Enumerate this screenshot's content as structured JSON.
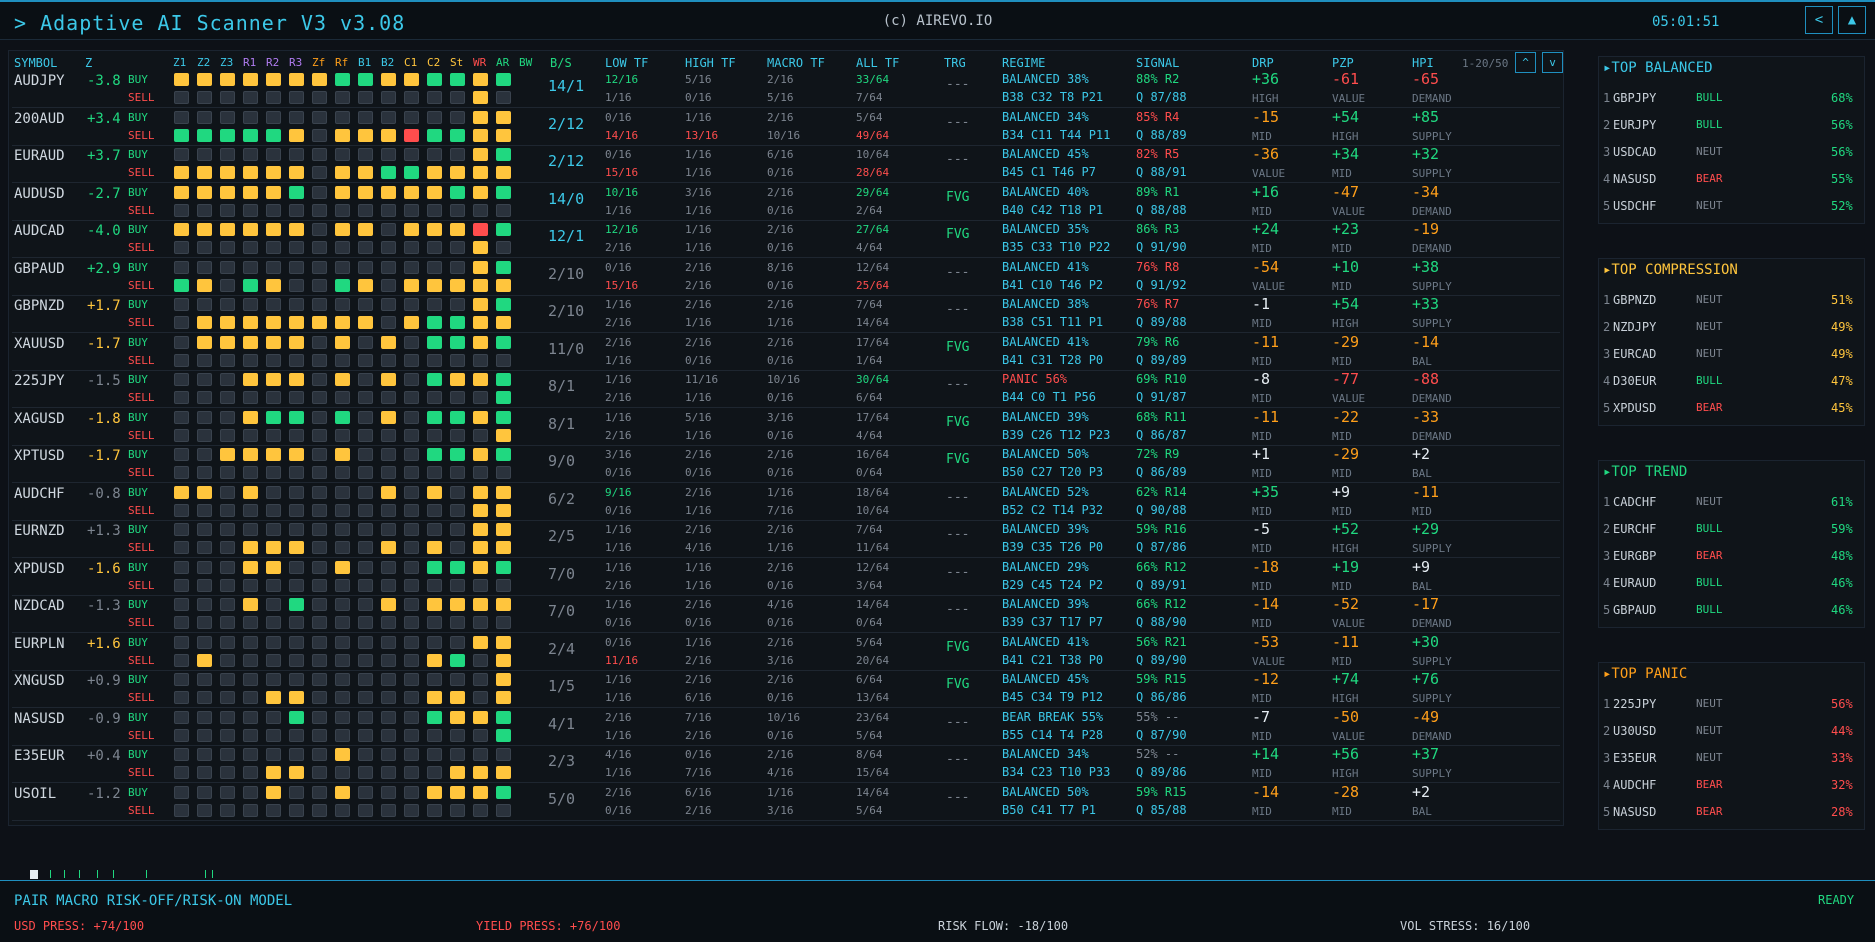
{
  "header": {
    "title": "> Adaptive AI Scanner V3 v3.08",
    "copyright": "(c) AIREVO.IO",
    "time": "05:01:51",
    "prev_icon": "<",
    "up_icon": "▲"
  },
  "columns": [
    "SYMBOL",
    "Z",
    "Z1",
    "Z2",
    "Z3",
    "R1",
    "R2",
    "R3",
    "Zf",
    "Rf",
    "B1",
    "B2",
    "C1",
    "C2",
    "St",
    "WR",
    "AR",
    "BW",
    "B/S",
    "LOW TF",
    "HIGH TF",
    "MACRO TF",
    "ALL TF",
    "TRG",
    "REGIME",
    "SIGNAL",
    "DRP",
    "PZP",
    "HPI"
  ],
  "pager": {
    "range": "1-20/50",
    "up": "^",
    "down": "v"
  },
  "side_labels": {
    "buy": "BUY",
    "sell": "SELL"
  },
  "colors": {
    "accent": "#3cc8e8",
    "green": "#20d880",
    "yellow": "#ffc53d",
    "red": "#ff4d4d",
    "orange": "#ff9f1a",
    "gray": "#7d8590"
  },
  "rows": [
    {
      "symbol": "AUDJPY",
      "z": "-3.8",
      "zc": "green",
      "bs": "14/1",
      "bsc": "cyan",
      "tf": [
        "12/16",
        "1/16",
        "5/16",
        "0/16",
        "2/16",
        "5/16",
        "33/64",
        "7/64"
      ],
      "trg": "---",
      "regime": "BALANCED 38%",
      "regime_sub": "B38 C32 T8 P21",
      "sig": "88% R2",
      "sig_sub": "Q 87/88",
      "drp": "+36",
      "drp_l": "HIGH",
      "pzp": "-61",
      "pzp_l": "VALUE",
      "hpi": "-65",
      "hpi_l": "DEMAND",
      "buy": "YYYYYYYGGYYGGYG",
      "sell": "KKKKKKKKKKKKKYK"
    },
    {
      "symbol": "200AUD",
      "z": "+3.4",
      "zc": "green",
      "bs": "2/12",
      "bsc": "cyan",
      "tf": [
        "0/16",
        "14/16",
        "1/16",
        "13/16",
        "2/16",
        "10/16",
        "5/64",
        "49/64"
      ],
      "trg": "---",
      "regime": "BALANCED 34%",
      "regime_sub": "B34 C11 T44 P11",
      "sig": "85% R4",
      "sig_sub": "Q 88/89",
      "drp": "-15",
      "drp_l": "MID",
      "pzp": "+54",
      "pzp_l": "HIGH",
      "hpi": "+85",
      "hpi_l": "SUPPLY",
      "buy": "KKKKKKKKKKKKKYY",
      "sell": "GGGGGYKYYYRGGYY"
    },
    {
      "symbol": "EURAUD",
      "z": "+3.7",
      "zc": "green",
      "bs": "2/12",
      "bsc": "cyan",
      "tf": [
        "0/16",
        "15/16",
        "1/16",
        "1/16",
        "6/16",
        "0/16",
        "10/64",
        "28/64"
      ],
      "trg": "---",
      "regime": "BALANCED 45%",
      "regime_sub": "B45 C1 T46 P7",
      "sig": "82% R5",
      "sig_sub": "Q 88/91",
      "drp": "-36",
      "drp_l": "VALUE",
      "pzp": "+34",
      "pzp_l": "MID",
      "hpi": "+32",
      "hpi_l": "SUPPLY",
      "buy": "KKKKKKKKKKKKKYG",
      "sell": "YYYYYYKYYGGYYYY"
    },
    {
      "symbol": "AUDUSD",
      "z": "-2.7",
      "zc": "green",
      "bs": "14/0",
      "bsc": "cyan",
      "tf": [
        "10/16",
        "1/16",
        "3/16",
        "1/16",
        "2/16",
        "0/16",
        "29/64",
        "2/64"
      ],
      "trg": "FVG",
      "regime": "BALANCED 40%",
      "regime_sub": "B40 C42 T18 P1",
      "sig": "89% R1",
      "sig_sub": "Q 88/88",
      "drp": "+16",
      "drp_l": "MID",
      "pzp": "-47",
      "pzp_l": "VALUE",
      "hpi": "-34",
      "hpi_l": "DEMAND",
      "buy": "YYYYYGKYYYYYGYG",
      "sell": "KKKKKKKKKKKKKKK"
    },
    {
      "symbol": "AUDCAD",
      "z": "-4.0",
      "zc": "green",
      "bs": "12/1",
      "bsc": "cyan",
      "tf": [
        "12/16",
        "2/16",
        "1/16",
        "1/16",
        "2/16",
        "0/16",
        "27/64",
        "4/64"
      ],
      "trg": "FVG",
      "regime": "BALANCED 35%",
      "regime_sub": "B35 C33 T10 P22",
      "sig": "86% R3",
      "sig_sub": "Q 91/90",
      "drp": "+24",
      "drp_l": "MID",
      "pzp": "+23",
      "pzp_l": "MID",
      "hpi": "-19",
      "hpi_l": "DEMAND",
      "buy": "YYYYYYKYYKYYYRG",
      "sell": "KKKKKKKKKKKKKYK"
    },
    {
      "symbol": "GBPAUD",
      "z": "+2.9",
      "zc": "green",
      "bs": "2/10",
      "bsc": "gray",
      "tf": [
        "0/16",
        "15/16",
        "2/16",
        "2/16",
        "8/16",
        "0/16",
        "12/64",
        "25/64"
      ],
      "trg": "---",
      "regime": "BALANCED 41%",
      "regime_sub": "B41 C10 T46 P2",
      "sig": "76% R8",
      "sig_sub": "Q 91/92",
      "drp": "-54",
      "drp_l": "VALUE",
      "pzp": "+10",
      "pzp_l": "MID",
      "hpi": "+38",
      "hpi_l": "SUPPLY",
      "buy": "KKKKKKKKKKKKKYG",
      "sell": "GYKGYKKGYKYYYYY"
    },
    {
      "symbol": "GBPNZD",
      "z": "+1.7",
      "zc": "yellow",
      "bs": "2/10",
      "bsc": "gray",
      "tf": [
        "1/16",
        "2/16",
        "2/16",
        "1/16",
        "2/16",
        "1/16",
        "7/64",
        "14/64"
      ],
      "trg": "---",
      "regime": "BALANCED 38%",
      "regime_sub": "B38 C51 T11 P1",
      "sig": "76% R7",
      "sig_sub": "Q 89/88",
      "drp": "-1",
      "drp_l": "MID",
      "pzp": "+54",
      "pzp_l": "HIGH",
      "hpi": "+33",
      "hpi_l": "SUPPLY",
      "buy": "KKKKKKKKKKKKKYG",
      "sell": "KYYYYYYYYKYGGYY"
    },
    {
      "symbol": "XAUUSD",
      "z": "-1.7",
      "zc": "yellow",
      "bs": "11/0",
      "bsc": "gray",
      "tf": [
        "2/16",
        "1/16",
        "2/16",
        "0/16",
        "2/16",
        "0/16",
        "17/64",
        "1/64"
      ],
      "trg": "FVG",
      "regime": "BALANCED 41%",
      "regime_sub": "B41 C31 T28 P0",
      "sig": "79% R6",
      "sig_sub": "Q 89/89",
      "drp": "-11",
      "drp_l": "MID",
      "pzp": "-29",
      "pzp_l": "MID",
      "hpi": "-14",
      "hpi_l": "BAL",
      "buy": "KYYYYYKYKYKGGYG",
      "sell": "KKKKKKKKKKKKKKK"
    },
    {
      "symbol": "225JPY",
      "z": "-1.5",
      "zc": "gray",
      "bs": "8/1",
      "bsc": "gray",
      "tf": [
        "1/16",
        "2/16",
        "11/16",
        "1/16",
        "10/16",
        "0/16",
        "30/64",
        "6/64"
      ],
      "trg": "---",
      "regime": "PANIC 56%",
      "regime_sub": "B44 C0 T1 P56",
      "sig": "69% R10",
      "sig_sub": "Q 91/87",
      "drp": "-8",
      "drp_l": "MID",
      "pzp": "-77",
      "pzp_l": "VALUE",
      "hpi": "-88",
      "hpi_l": "DEMAND",
      "buy": "KKKYYYKYKYKGYYG",
      "sell": "KKKKKKKKKKKKKKG"
    },
    {
      "symbol": "XAGUSD",
      "z": "-1.8",
      "zc": "yellow",
      "bs": "8/1",
      "bsc": "gray",
      "tf": [
        "1/16",
        "2/16",
        "5/16",
        "1/16",
        "3/16",
        "0/16",
        "17/64",
        "4/64"
      ],
      "trg": "FVG",
      "regime": "BALANCED 39%",
      "regime_sub": "B39 C26 T12 P23",
      "sig": "68% R11",
      "sig_sub": "Q 86/87",
      "drp": "-11",
      "drp_l": "MID",
      "pzp": "-22",
      "pzp_l": "MID",
      "hpi": "-33",
      "hpi_l": "DEMAND",
      "buy": "KKKYGGKGKYKGGYG",
      "sell": "KKKKKKKKKKKKKKY"
    },
    {
      "symbol": "XPTUSD",
      "z": "-1.7",
      "zc": "yellow",
      "bs": "9/0",
      "bsc": "gray",
      "tf": [
        "3/16",
        "0/16",
        "2/16",
        "0/16",
        "2/16",
        "0/16",
        "16/64",
        "0/64"
      ],
      "trg": "FVG",
      "regime": "BALANCED 50%",
      "regime_sub": "B50 C27 T20 P3",
      "sig": "72% R9",
      "sig_sub": "Q 86/89",
      "drp": "+1",
      "drp_l": "MID",
      "pzp": "-29",
      "pzp_l": "MID",
      "hpi": "+2",
      "hpi_l": "BAL",
      "buy": "KKYYYYKYKKKGGYG",
      "sell": "KKKKKKKKKKKKKKK"
    },
    {
      "symbol": "AUDCHF",
      "z": "-0.8",
      "zc": "gray",
      "bs": "6/2",
      "bsc": "gray",
      "tf": [
        "9/16",
        "0/16",
        "2/16",
        "1/16",
        "1/16",
        "7/16",
        "18/64",
        "10/64"
      ],
      "trg": "---",
      "regime": "BALANCED 52%",
      "regime_sub": "B52 C2 T14 P32",
      "sig": "62% R14",
      "sig_sub": "Q 90/88",
      "drp": "+35",
      "drp_l": "MID",
      "pzp": "+9",
      "pzp_l": "MID",
      "hpi": "-11",
      "hpi_l": "MID",
      "buy": "YYKYKKKKKYKYKYY",
      "sell": "KKKKKKKKKKKKKYY"
    },
    {
      "symbol": "EURNZD",
      "z": "+1.3",
      "zc": "gray",
      "bs": "2/5",
      "bsc": "gray",
      "tf": [
        "1/16",
        "1/16",
        "2/16",
        "4/16",
        "2/16",
        "1/16",
        "7/64",
        "11/64"
      ],
      "trg": "---",
      "regime": "BALANCED 39%",
      "regime_sub": "B39 C35 T26 P0",
      "sig": "59% R16",
      "sig_sub": "Q 87/86",
      "drp": "-5",
      "drp_l": "MID",
      "pzp": "+52",
      "pzp_l": "HIGH",
      "hpi": "+29",
      "hpi_l": "SUPPLY",
      "buy": "KKKKKKKKKKKKKYY",
      "sell": "KKKYYYKKKYKYKYY"
    },
    {
      "symbol": "XPDUSD",
      "z": "-1.6",
      "zc": "yellow",
      "bs": "7/0",
      "bsc": "gray",
      "tf": [
        "1/16",
        "2/16",
        "1/16",
        "1/16",
        "2/16",
        "0/16",
        "12/64",
        "3/64"
      ],
      "trg": "---",
      "regime": "BALANCED 29%",
      "regime_sub": "B29 C45 T24 P2",
      "sig": "66% R12",
      "sig_sub": "Q 89/91",
      "drp": "-18",
      "drp_l": "MID",
      "pzp": "+19",
      "pzp_l": "MID",
      "hpi": "+9",
      "hpi_l": "BAL",
      "buy": "KKKYYKKYKKKGGYG",
      "sell": "KKKKKKKKKKKKKKK"
    },
    {
      "symbol": "NZDCAD",
      "z": "-1.3",
      "zc": "gray",
      "bs": "7/0",
      "bsc": "gray",
      "tf": [
        "1/16",
        "0/16",
        "2/16",
        "0/16",
        "4/16",
        "0/16",
        "14/64",
        "0/64"
      ],
      "trg": "---",
      "regime": "BALANCED 39%",
      "regime_sub": "B39 C37 T17 P7",
      "sig": "66% R12",
      "sig_sub": "Q 88/90",
      "drp": "-14",
      "drp_l": "MID",
      "pzp": "-52",
      "pzp_l": "VALUE",
      "hpi": "-17",
      "hpi_l": "DEMAND",
      "buy": "KKKYKGKKKYKYYYY",
      "sell": "KKKKKKKKKKKKKKK"
    },
    {
      "symbol": "EURPLN",
      "z": "+1.6",
      "zc": "yellow",
      "bs": "2/4",
      "bsc": "gray",
      "tf": [
        "0/16",
        "11/16",
        "1/16",
        "2/16",
        "2/16",
        "3/16",
        "5/64",
        "20/64"
      ],
      "trg": "FVG",
      "regime": "BALANCED 41%",
      "regime_sub": "B41 C21 T38 P0",
      "sig": "56% R21",
      "sig_sub": "Q 89/90",
      "drp": "-53",
      "drp_l": "VALUE",
      "pzp": "-11",
      "pzp_l": "MID",
      "hpi": "+30",
      "hpi_l": "SUPPLY",
      "buy": "KKKKKKKKKKKKKYY",
      "sell": "KYKKKKKKKKKYGKY"
    },
    {
      "symbol": "XNGUSD",
      "z": "+0.9",
      "zc": "gray",
      "bs": "1/5",
      "bsc": "gray",
      "tf": [
        "1/16",
        "1/16",
        "2/16",
        "6/16",
        "2/16",
        "0/16",
        "6/64",
        "13/64"
      ],
      "trg": "FVG",
      "regime": "BALANCED 45%",
      "regime_sub": "B45 C34 T9 P12",
      "sig": "59% R15",
      "sig_sub": "Q 86/86",
      "drp": "-12",
      "drp_l": "MID",
      "pzp": "+74",
      "pzp_l": "HIGH",
      "hpi": "+76",
      "hpi_l": "SUPPLY",
      "buy": "KKKKKKKKKKKKKKY",
      "sell": "KKKKYYKKKKKYYKY"
    },
    {
      "symbol": "NASUSD",
      "z": "-0.9",
      "zc": "gray",
      "bs": "4/1",
      "bsc": "gray",
      "tf": [
        "2/16",
        "1/16",
        "7/16",
        "2/16",
        "10/16",
        "0/16",
        "23/64",
        "5/64"
      ],
      "trg": "---",
      "regime": "BEAR BREAK 55%",
      "regime_sub": "B55 C14 T4 P28",
      "sig": "55% --",
      "sig_sub": "Q 87/90",
      "drp": "-7",
      "drp_l": "MID",
      "pzp": "-50",
      "pzp_l": "VALUE",
      "hpi": "-49",
      "hpi_l": "DEMAND",
      "buy": "KKKKKGKKKKKGYYG",
      "sell": "KKKKKKKKKKKKKKG"
    },
    {
      "symbol": "E35EUR",
      "z": "+0.4",
      "zc": "gray",
      "bs": "2/3",
      "bsc": "gray",
      "tf": [
        "4/16",
        "1/16",
        "0/16",
        "7/16",
        "2/16",
        "4/16",
        "8/64",
        "15/64"
      ],
      "trg": "---",
      "regime": "BALANCED 34%",
      "regime_sub": "B34 C23 T10 P33",
      "sig": "52% --",
      "sig_sub": "Q 89/86",
      "drp": "+14",
      "drp_l": "MID",
      "pzp": "+56",
      "pzp_l": "HIGH",
      "hpi": "+37",
      "hpi_l": "SUPPLY",
      "buy": "KKKKKKKYKKKKKKK",
      "sell": "KKKKYYKKKKKKYYY"
    },
    {
      "symbol": "USOIL",
      "z": "-1.2",
      "zc": "gray",
      "bs": "5/0",
      "bsc": "gray",
      "tf": [
        "2/16",
        "0/16",
        "6/16",
        "2/16",
        "1/16",
        "3/16",
        "14/64",
        "5/64"
      ],
      "trg": "---",
      "regime": "BALANCED 50%",
      "regime_sub": "B50 C41 T7 P1",
      "sig": "59% R15",
      "sig_sub": "Q 85/88",
      "drp": "-14",
      "drp_l": "MID",
      "pzp": "-28",
      "pzp_l": "MID",
      "hpi": "+2",
      "hpi_l": "BAL",
      "buy": "KKKKYKKYKKKYYYG",
      "sell": "KKKKKKKKKKKKKKK"
    }
  ],
  "side_panels": [
    {
      "title": "▸TOP BALANCED",
      "color": "#3cc8e8",
      "items": [
        [
          "1",
          "GBPJPY",
          "BULL",
          "68%"
        ],
        [
          "2",
          "EURJPY",
          "BULL",
          "56%"
        ],
        [
          "3",
          "USDCAD",
          "NEUT",
          "56%"
        ],
        [
          "4",
          "NASUSD",
          "BEAR",
          "55%"
        ],
        [
          "5",
          "USDCHF",
          "NEUT",
          "52%"
        ]
      ]
    },
    {
      "title": "▸TOP COMPRESSION",
      "color": "#ffc53d",
      "items": [
        [
          "1",
          "GBPNZD",
          "NEUT",
          "51%"
        ],
        [
          "2",
          "NZDJPY",
          "NEUT",
          "49%"
        ],
        [
          "3",
          "EURCAD",
          "NEUT",
          "49%"
        ],
        [
          "4",
          "D30EUR",
          "BULL",
          "47%"
        ],
        [
          "5",
          "XPDUSD",
          "BEAR",
          "45%"
        ]
      ]
    },
    {
      "title": "▸TOP TREND",
      "color": "#20d880",
      "items": [
        [
          "1",
          "CADCHF",
          "NEUT",
          "61%"
        ],
        [
          "2",
          "EURCHF",
          "BULL",
          "59%"
        ],
        [
          "3",
          "EURGBP",
          "BEAR",
          "48%"
        ],
        [
          "4",
          "EURAUD",
          "BULL",
          "46%"
        ],
        [
          "5",
          "GBPAUD",
          "BULL",
          "46%"
        ]
      ]
    },
    {
      "title": "▸TOP PANIC",
      "color": "#ff9f1a",
      "items": [
        [
          "1",
          "225JPY",
          "NEUT",
          "56%"
        ],
        [
          "2",
          "U30USD",
          "NEUT",
          "44%"
        ],
        [
          "3",
          "E35EUR",
          "NEUT",
          "33%"
        ],
        [
          "4",
          "AUDCHF",
          "BEAR",
          "32%"
        ],
        [
          "5",
          "NASUSD",
          "BEAR",
          "28%"
        ]
      ]
    }
  ],
  "footer": {
    "model": "PAIR MACRO RISK-OFF/RISK-ON MODEL",
    "status": "READY",
    "usd": "USD PRESS: +74/100",
    "yield": "YIELD PRESS: +76/100",
    "risk": "RISK FLOW: -18/100",
    "vol": "VOL STRESS: 16/100"
  }
}
